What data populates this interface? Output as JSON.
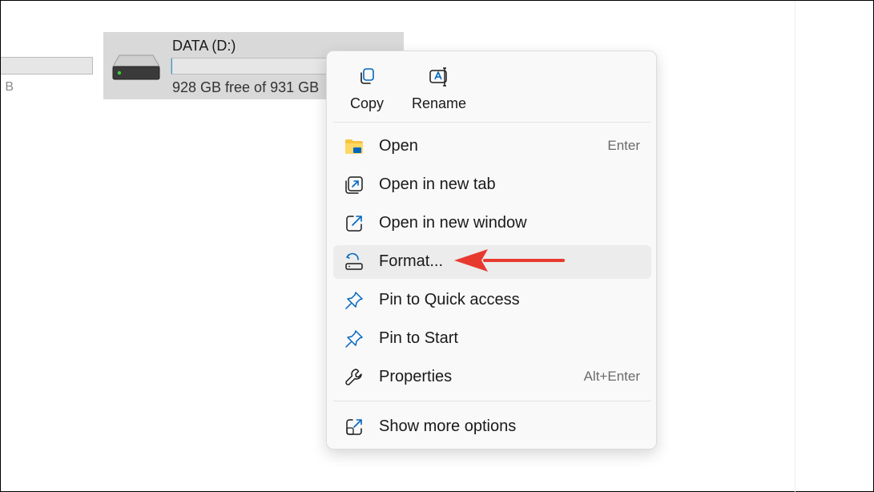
{
  "background": {
    "partial_drive_text": "B"
  },
  "drive": {
    "name": "DATA (D:)",
    "free_text": "928 GB free of 931 GB",
    "used_fraction": 0.003
  },
  "context_menu": {
    "quick_actions": [
      {
        "label": "Copy",
        "icon": "copy-icon"
      },
      {
        "label": "Rename",
        "icon": "rename-icon"
      }
    ],
    "items": [
      {
        "label": "Open",
        "shortcut": "Enter",
        "icon": "folder-icon"
      },
      {
        "label": "Open in new tab",
        "shortcut": "",
        "icon": "new-tab-icon"
      },
      {
        "label": "Open in new window",
        "shortcut": "",
        "icon": "new-window-icon"
      },
      {
        "label": "Format...",
        "shortcut": "",
        "icon": "format-icon",
        "highlighted": true
      },
      {
        "label": "Pin to Quick access",
        "shortcut": "",
        "icon": "pin-icon"
      },
      {
        "label": "Pin to Start",
        "shortcut": "",
        "icon": "pin-icon"
      },
      {
        "label": "Properties",
        "shortcut": "Alt+Enter",
        "icon": "wrench-icon"
      },
      {
        "label": "Show more options",
        "shortcut": "",
        "icon": "more-options-icon"
      }
    ]
  },
  "colors": {
    "accent": "#0067c0",
    "arrow": "#e8392e",
    "folder": "#f5c542",
    "drive_led": "#3ad13a"
  }
}
